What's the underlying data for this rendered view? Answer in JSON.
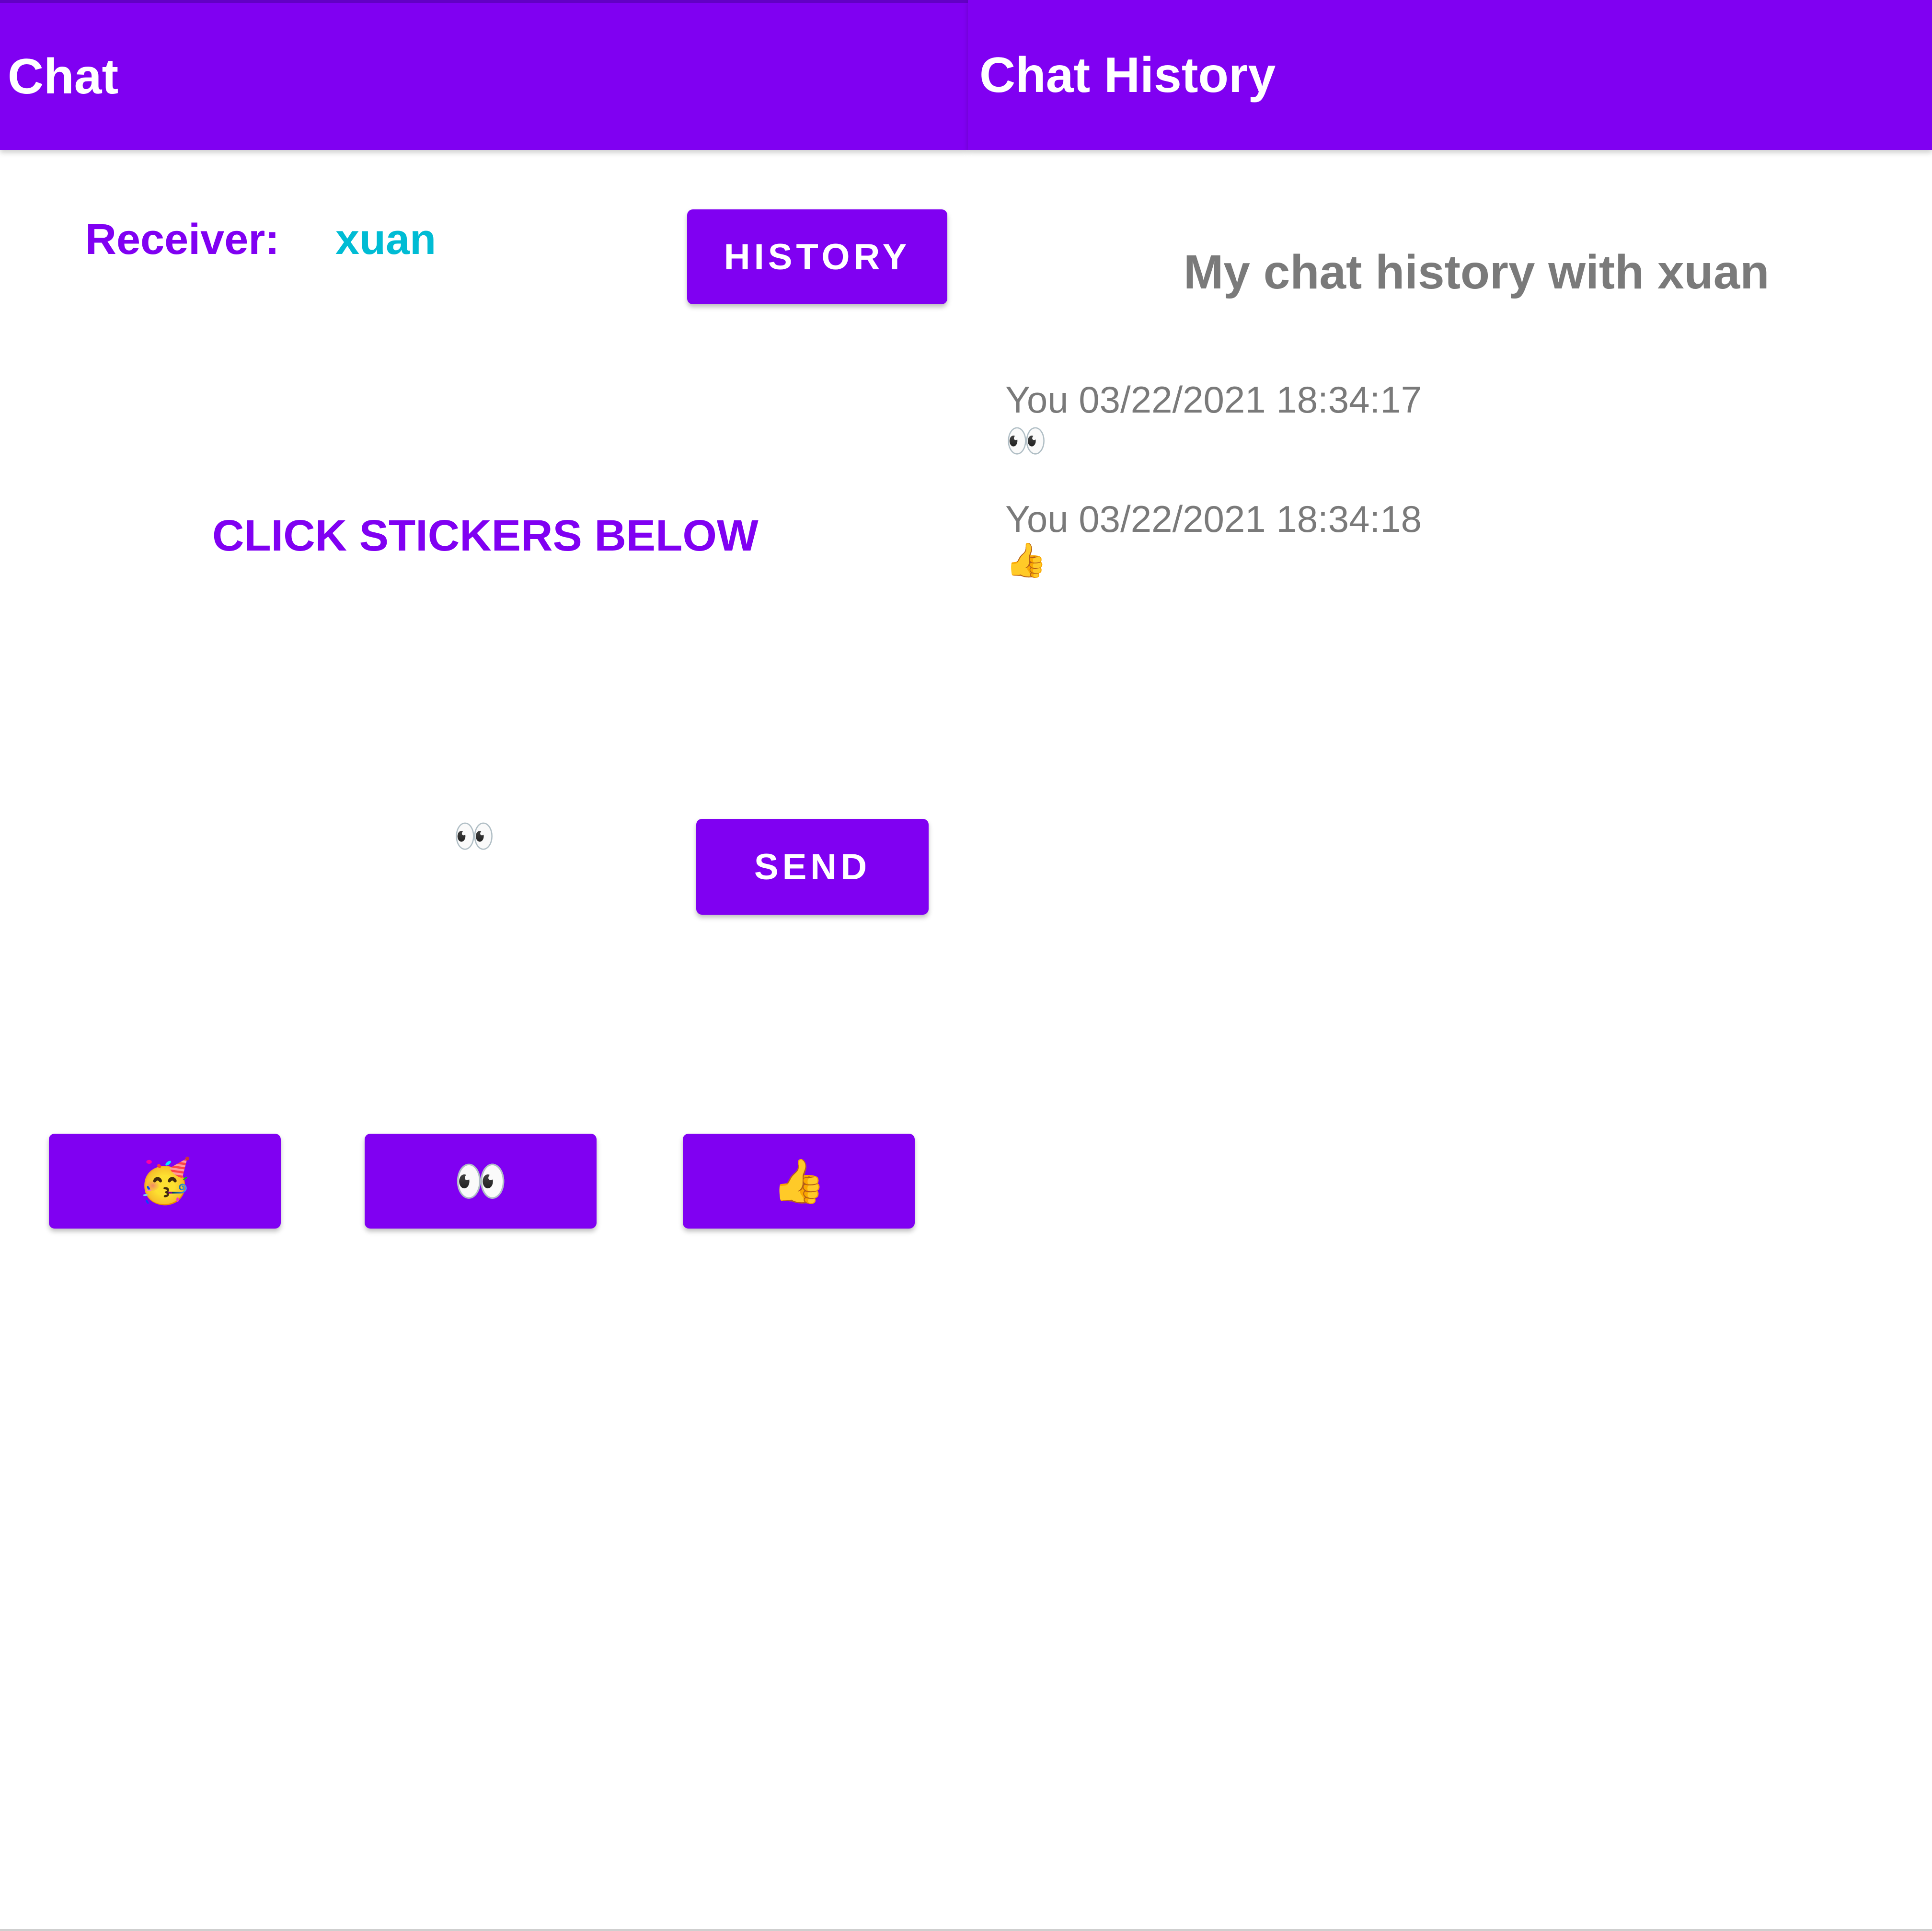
{
  "chat_screen": {
    "title": "Chat",
    "receiver_label": "Receiver:",
    "receiver_name": "xuan",
    "history_button": "HISTORY",
    "instruction": "CLICK STICKERS BELOW",
    "selected_sticker": "👀",
    "send_button": "SEND",
    "stickers": [
      {
        "emoji": "🥳",
        "icon": "party-face-icon"
      },
      {
        "emoji": "👀",
        "icon": "eyes-icon"
      },
      {
        "emoji": "👍",
        "icon": "thumbs-up-icon"
      }
    ]
  },
  "history_screen": {
    "title": "Chat History",
    "heading": "My chat history with xuan",
    "messages": [
      {
        "sender_time": "You 03/22/2021 18:34:17",
        "content": "👀"
      },
      {
        "sender_time": "You 03/22/2021 18:34:18",
        "content": "👍"
      }
    ]
  },
  "colors": {
    "primary": "#8000f2",
    "receiver_accent": "#00bcd4",
    "history_text": "#7a7a7a"
  }
}
